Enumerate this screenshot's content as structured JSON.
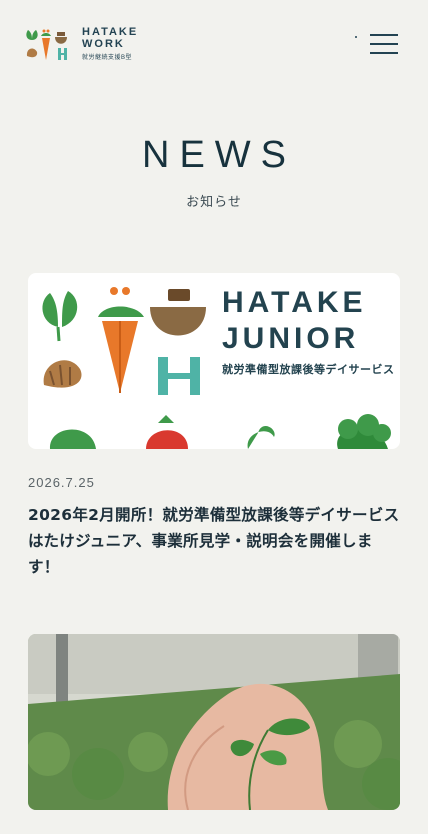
{
  "header": {
    "logo_line1": "HATAKE",
    "logo_line2": "WORK",
    "logo_sub": "就労継続支援B型",
    "menu_icon": "hamburger-icon"
  },
  "page": {
    "title": "NEWS",
    "subtitle": "お知らせ"
  },
  "news": [
    {
      "image_brand_line1": "HATAKE",
      "image_brand_line2": "JUNIOR",
      "image_brand_jp": "就労準備型放課後等デイサービス",
      "date": "2026.7.25",
      "title": "2026年2月開所！就労準備型放課後等デイサービス はたけジュニア、事業所見学・説明会を開催します！"
    },
    {
      "image_desc_icon": "seedling-photo-icon"
    }
  ],
  "colors": {
    "background": "#f2f2ee",
    "navy": "#17323d",
    "carrot": "#e8782a",
    "leaf": "#3f9a4a",
    "teal": "#4fb3a6"
  }
}
